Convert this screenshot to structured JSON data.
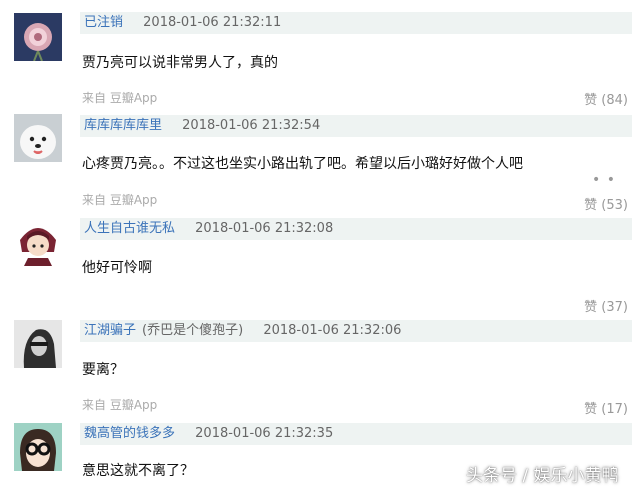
{
  "comments": [
    {
      "username": "已注销",
      "note": "",
      "timestamp": "2018-01-06 21:32:11",
      "text": "贾乃亮可以说非常男人了，真的",
      "source": "来自 豆瓣App",
      "likes": "赞 (84)",
      "avatar_icon": "flower-avatar-icon"
    },
    {
      "username": "库库库库库里",
      "note": "",
      "timestamp": "2018-01-06 21:32:54",
      "text": "心疼贾乃亮。。不过这也坐实小路出轨了吧。希望以后小璐好好做个人吧",
      "source": "来自 豆瓣App",
      "likes": "赞 (53)",
      "avatar_icon": "dog-avatar-icon"
    },
    {
      "username": "人生自古谁无私",
      "note": "",
      "timestamp": "2018-01-06 21:32:08",
      "text": "他好可怜啊",
      "source": "",
      "likes": "赞 (37)",
      "avatar_icon": "cartoon-girl-avatar-icon"
    },
    {
      "username": "江湖骗子",
      "note": "(乔巴是个傻孢子)",
      "timestamp": "2018-01-06 21:32:06",
      "text": "要离？",
      "source": "来自 豆瓣App",
      "likes": "赞 (17)",
      "avatar_icon": "bw-photo-avatar-icon"
    },
    {
      "username": "魏高管的钱多多",
      "note": "",
      "timestamp": "2018-01-06 21:32:35",
      "text": "意思这就不离了？",
      "source": "",
      "likes": "",
      "avatar_icon": "glasses-avatar-icon"
    }
  ],
  "watermark": "头条号 / 娱乐小黄鸭",
  "colors": {
    "header_bg": "#eef3f2",
    "username": "#3b73b9",
    "meta": "#aaaaaa"
  }
}
